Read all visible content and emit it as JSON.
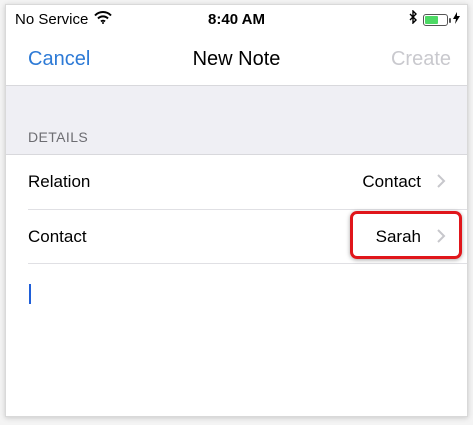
{
  "status_bar": {
    "carrier": "No Service",
    "time": "8:40 AM",
    "battery_level": 0.6
  },
  "nav": {
    "cancel_label": "Cancel",
    "title": "New Note",
    "create_label": "Create"
  },
  "section": {
    "header": "DETAILS"
  },
  "rows": [
    {
      "label": "Relation",
      "value": "Contact"
    },
    {
      "label": "Contact",
      "value": "Sarah"
    }
  ],
  "colors": {
    "accent": "#2d7ad6",
    "disabled": "#c9c9ce",
    "highlight": "#e0161b",
    "battery": "#4cd964"
  }
}
